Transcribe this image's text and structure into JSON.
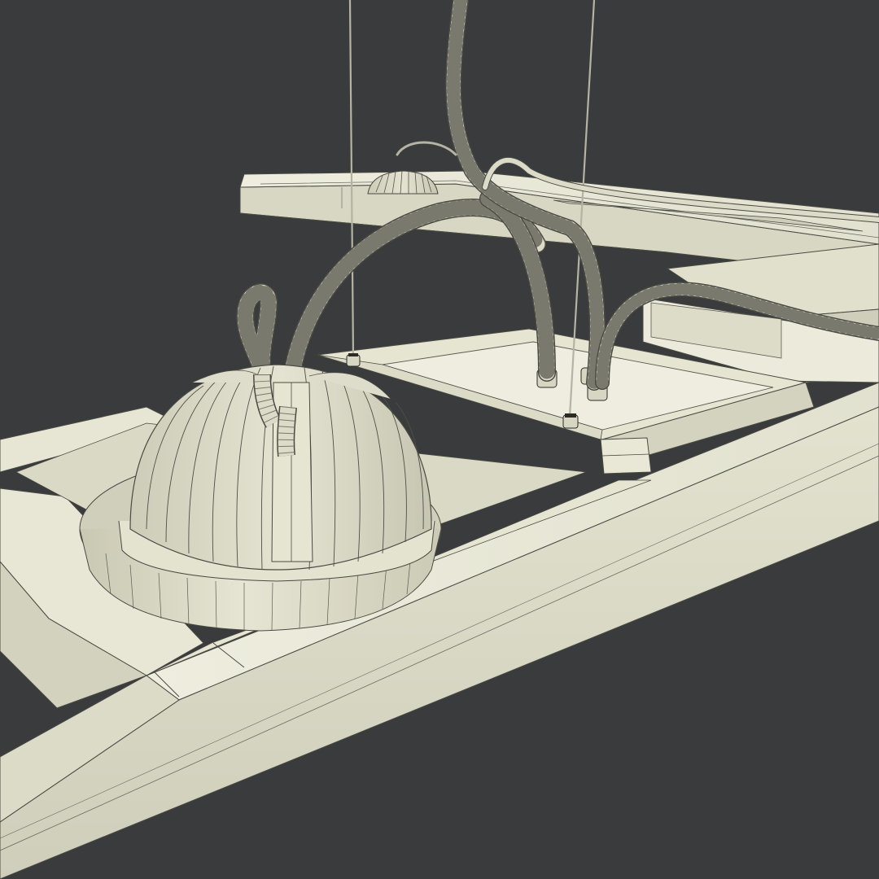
{
  "scene": {
    "subject": "suspended-linear-light-fixture-wireframe",
    "colors": {
      "background": "#3a3b3c",
      "surface_light": "#e9e8d8",
      "surface_mid": "#d6d5c1",
      "surface_shadow": "#b9b8a3",
      "wire_edges": "#4a4a44",
      "cable": "#dcdbc8",
      "steel_wire": "#b4b3a4",
      "connector_dark": "#2b2b28"
    }
  }
}
